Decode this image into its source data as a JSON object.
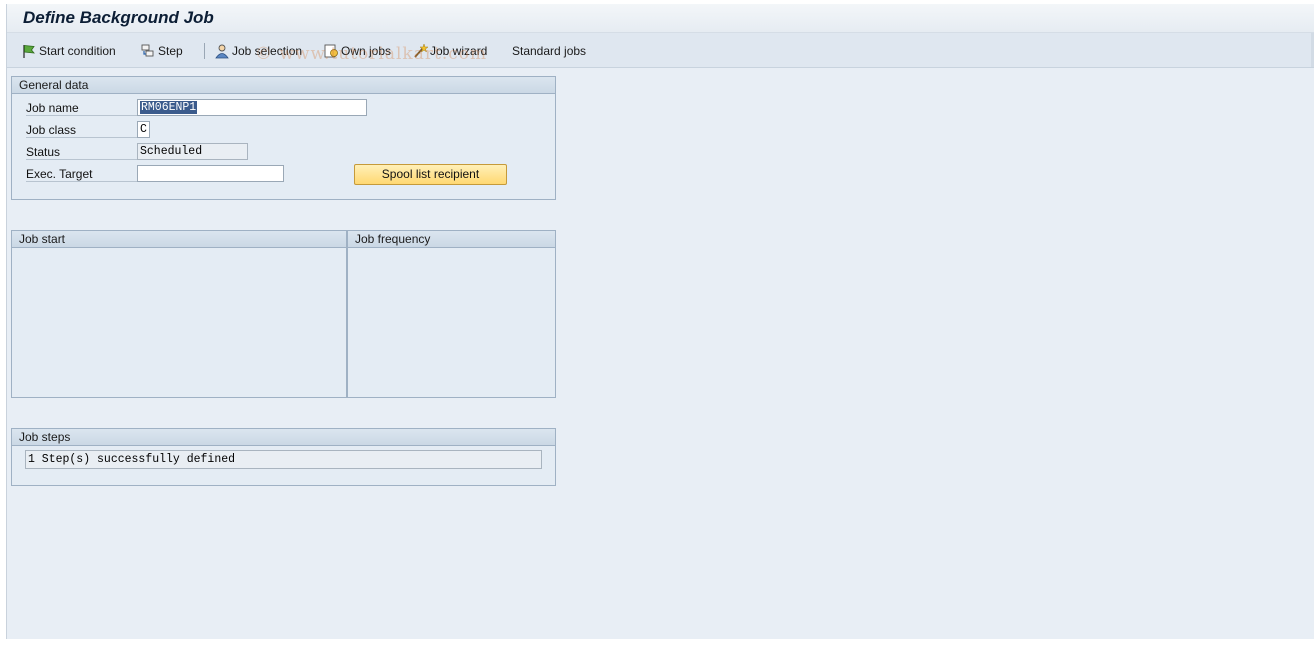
{
  "window": {
    "title": "Define Background Job"
  },
  "toolbar": {
    "start_condition": "Start condition",
    "step": "Step",
    "job_selection": "Job selection",
    "own_jobs": "Own jobs",
    "job_wizard": "Job wizard",
    "standard_jobs": "Standard jobs"
  },
  "watermark": "© www.tutorialkart.com",
  "general_data": {
    "header": "General data",
    "job_name_label": "Job name",
    "job_name_value": "RM06ENP1",
    "job_class_label": "Job class",
    "job_class_value": "C",
    "status_label": "Status",
    "status_value": "Scheduled",
    "exec_target_label": "Exec. Target",
    "exec_target_value": "",
    "spool_button": "Spool list recipient"
  },
  "job_start": {
    "header": "Job start"
  },
  "job_frequency": {
    "header": "Job frequency"
  },
  "job_steps": {
    "header": "Job steps",
    "message": "1 Step(s) successfully defined"
  },
  "colors": {
    "background": "#e8eef5",
    "button_yellow": "#ffd872",
    "selection": "#3b5b8c"
  },
  "icons": {
    "start_condition": "flag-icon",
    "step": "step-icon",
    "job_selection": "person-icon",
    "own_jobs": "own-jobs-icon",
    "job_wizard": "wizard-wand-icon"
  }
}
